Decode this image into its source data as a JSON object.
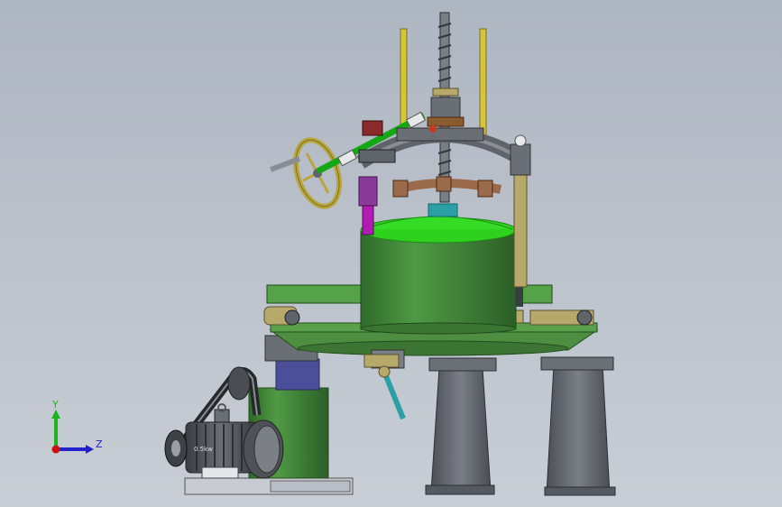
{
  "viewport": {
    "background_top": "#aeb6c2",
    "background_bottom": "#c9ced5"
  },
  "triad": {
    "y_label": "Y",
    "z_label": "Z",
    "y_color": "#1cb41c",
    "z_color": "#2222cc",
    "x_color": "#cc1111"
  },
  "motor": {
    "nameplate_text": "0.5kw"
  },
  "colors": {
    "body_green": "#4b8f3e",
    "bright_green": "#2fd11f",
    "olive": "#b7a96a",
    "dark_gray": "#5f636a",
    "magenta": "#b11cb3",
    "teal": "#2aa0a6",
    "yellow": "#d6c43a",
    "rust": "#9a6a4a"
  }
}
